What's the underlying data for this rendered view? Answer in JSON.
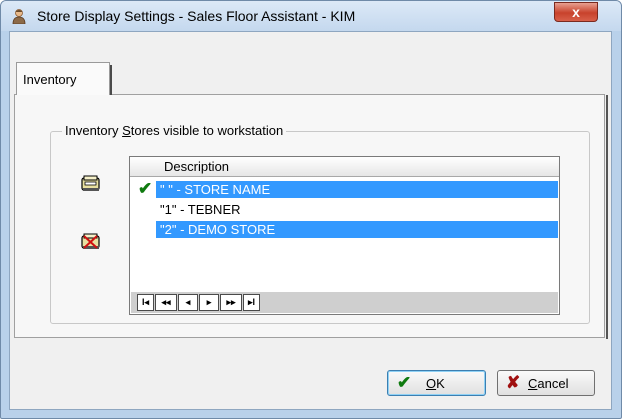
{
  "window": {
    "title": "Store Display Settings - Sales Floor Assistant - KIM",
    "close_label": "x"
  },
  "tabs": [
    {
      "label": "Inventory"
    }
  ],
  "group": {
    "label_pre": "Inventory ",
    "label_mnemonic": "S",
    "label_post": "tores visible to workstation"
  },
  "list": {
    "column_header": "Description",
    "rows": [
      {
        "text": "\" \" - STORE NAME",
        "selected": true,
        "checked": true
      },
      {
        "text": "\"1\" - TEBNER",
        "selected": false,
        "checked": false
      },
      {
        "text": "\"2\" - DEMO STORE",
        "selected": true,
        "checked": false
      }
    ],
    "check_glyph": "✔"
  },
  "navigator": {
    "buttons": [
      {
        "name": "first",
        "label": "I◂"
      },
      {
        "name": "prior-page",
        "label": "◂◂"
      },
      {
        "name": "prior",
        "label": "◂"
      },
      {
        "name": "next",
        "label": "▸"
      },
      {
        "name": "next-page",
        "label": "▸▸"
      },
      {
        "name": "last",
        "label": "▸I"
      }
    ]
  },
  "buttons": {
    "ok": {
      "glyph": "✔",
      "mnemonic": "O",
      "rest": "K"
    },
    "cancel": {
      "glyph": "✘",
      "mnemonic": "C",
      "rest": "ancel"
    }
  },
  "colors": {
    "selection": "#3399ff",
    "check": "#0f7a0f",
    "cancel_x": "#a01010",
    "close_button": "#c8422c"
  },
  "icons": {
    "app": "user-icon",
    "add_store": "add-store-icon",
    "remove_store": "remove-store-icon"
  }
}
